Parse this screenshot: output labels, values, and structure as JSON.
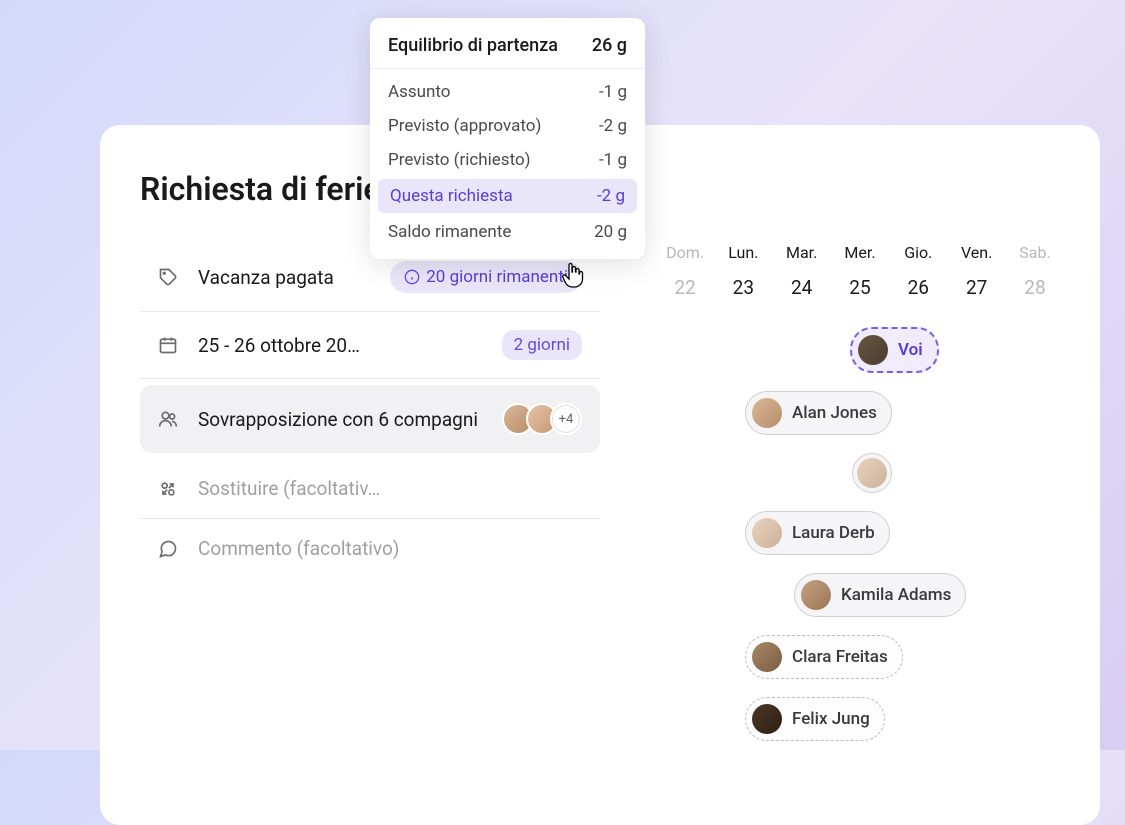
{
  "title": "Richiesta di ferie",
  "rows": {
    "leave_type": {
      "label": "Vacanza pagata",
      "badge": "20 giorni rimanenti"
    },
    "dates": {
      "label": "25 - 26 ottobre 20…",
      "pill": "2 giorni"
    },
    "overlap": {
      "label": "Sovrapposizione con 6 compagni",
      "more": "+4"
    },
    "substitute": {
      "label": "Sostituire (facoltativ…"
    },
    "comment": {
      "label": "Commento (facoltativo)"
    }
  },
  "popover": {
    "head": {
      "label": "Equilibrio di partenza",
      "value": "26 g"
    },
    "items": [
      {
        "label": "Assunto",
        "value": "-1 g"
      },
      {
        "label": "Previsto (approvato)",
        "value": "-2 g"
      },
      {
        "label": "Previsto (richiesto)",
        "value": "-1 g"
      }
    ],
    "highlight": {
      "label": "Questa richiesta",
      "value": "-2 g"
    },
    "remaining": {
      "label": "Saldo rimanente",
      "value": "20 g"
    }
  },
  "calendar": {
    "days": [
      "Dom.",
      "Lun.",
      "Mar.",
      "Mer.",
      "Gio.",
      "Ven.",
      "Sab."
    ],
    "dates": [
      "22",
      "23",
      "24",
      "25",
      "26",
      "27",
      "28"
    ]
  },
  "timeline": {
    "you": "Voi",
    "items": [
      {
        "name": "Alan Jones"
      },
      {
        "name": ""
      },
      {
        "name": "Laura Derb"
      },
      {
        "name": "Kamila Adams"
      },
      {
        "name": "Clara Freitas"
      },
      {
        "name": "Felix Jung"
      }
    ]
  }
}
